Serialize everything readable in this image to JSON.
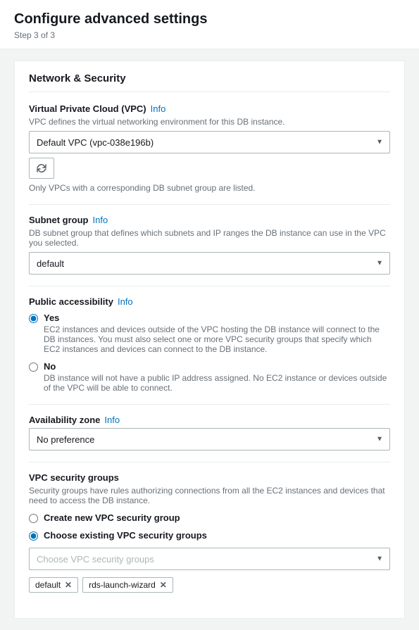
{
  "page": {
    "title": "Configure advanced settings",
    "step": "Step 3 of 3"
  },
  "section": {
    "title": "Network & Security",
    "vpc": {
      "label": "Virtual Private Cloud (VPC)",
      "info_label": "Info",
      "description": "VPC defines the virtual networking environment for this DB instance.",
      "selected": "Default VPC (vpc-038e196b)",
      "options": [
        "Default VPC (vpc-038e196b)"
      ],
      "refresh_note": "Only VPCs with a corresponding DB subnet group are listed."
    },
    "subnet": {
      "label": "Subnet group",
      "info_label": "Info",
      "description": "DB subnet group that defines which subnets and IP ranges the DB instance can use in the VPC you selected.",
      "selected": "default",
      "options": [
        "default"
      ]
    },
    "public_accessibility": {
      "label": "Public accessibility",
      "info_label": "Info",
      "options": [
        {
          "value": "yes",
          "label": "Yes",
          "description": "EC2 instances and devices outside of the VPC hosting the DB instance will connect to the DB instances. You must also select one or more VPC security groups that specify which EC2 instances and devices can connect to the DB instance.",
          "checked": true
        },
        {
          "value": "no",
          "label": "No",
          "description": "DB instance will not have a public IP address assigned. No EC2 instance or devices outside of the VPC will be able to connect.",
          "checked": false
        }
      ]
    },
    "availability_zone": {
      "label": "Availability zone",
      "info_label": "Info",
      "selected": "No preference",
      "options": [
        "No preference"
      ]
    },
    "vpc_security_groups": {
      "label": "VPC security groups",
      "description": "Security groups have rules authorizing connections from all the EC2 instances and devices that need to access the DB instance.",
      "options": [
        {
          "value": "create_new",
          "label": "Create new VPC security group",
          "checked": false
        },
        {
          "value": "choose_existing",
          "label": "Choose existing VPC security groups",
          "checked": true
        }
      ],
      "select_placeholder": "Choose VPC security groups",
      "tags": [
        {
          "label": "default",
          "removable": true
        },
        {
          "label": "rds-launch-wizard",
          "removable": true
        }
      ]
    }
  }
}
